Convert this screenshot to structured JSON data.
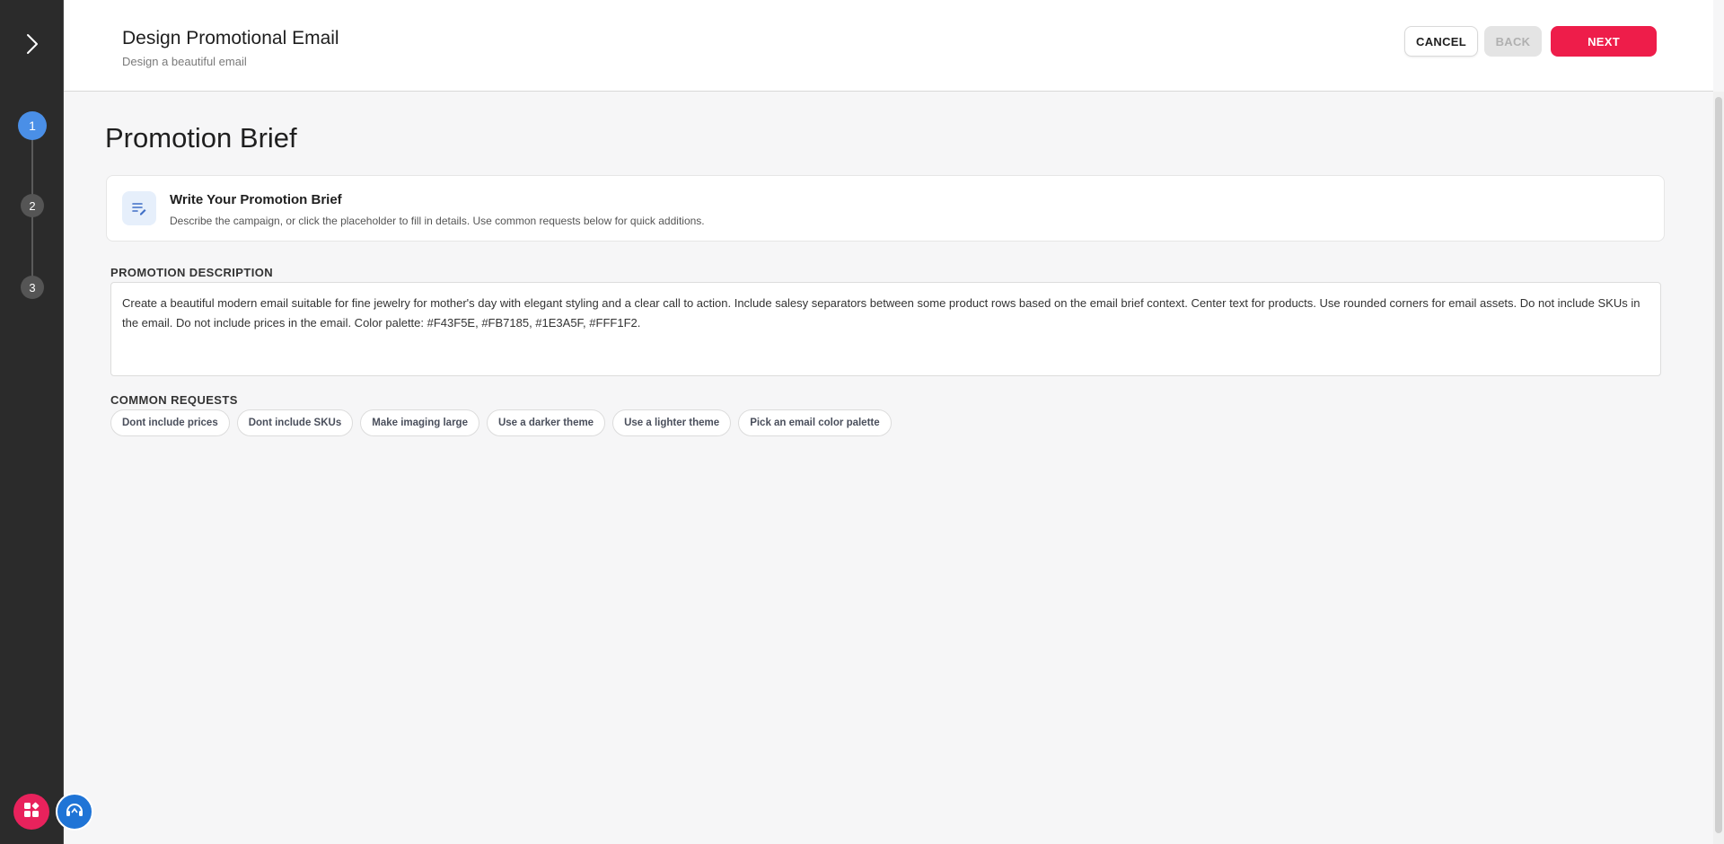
{
  "header": {
    "title": "Design Promotional Email",
    "subtitle": "Design a beautiful email",
    "cancel_label": "CANCEL",
    "back_label": "BACK",
    "next_label": "NEXT"
  },
  "steps": [
    {
      "number": "1",
      "active": true
    },
    {
      "number": "2",
      "active": false
    },
    {
      "number": "3",
      "active": false
    }
  ],
  "main": {
    "page_title": "Promotion Brief",
    "brief_card": {
      "title": "Write Your Promotion Brief",
      "description": "Describe the campaign, or click the placeholder to fill in details. Use common requests below for quick additions."
    },
    "promotion_description_label": "PROMOTION DESCRIPTION",
    "promotion_description_value": "Create a beautiful modern email suitable for fine jewelry for mother's day with elegant styling and a clear call to action. Include salesy separators between some product rows based on the email brief context. Center text for products. Use rounded corners for email assets. Do not include SKUs in the email. Do not include prices in the email. Color palette: #F43F5E, #FB7185, #1E3A5F, #FFF1F2.",
    "common_requests_label": "COMMON REQUESTS",
    "common_requests": [
      "Dont include prices",
      "Dont include SKUs",
      "Make imaging large",
      "Use a darker theme",
      "Use a lighter theme",
      "Pick an email color palette"
    ]
  },
  "colors": {
    "accent": "#ee1d4a",
    "step_active": "#4a8fe7",
    "rail_bg": "#2b2b2b",
    "fab_apps": "#e8225c",
    "fab_support": "#1f74d6"
  },
  "icons": {
    "rail_toggle": "chevron-right-icon",
    "brief": "edit-list-icon",
    "apps": "apps-grid-icon",
    "support": "headset-icon"
  }
}
